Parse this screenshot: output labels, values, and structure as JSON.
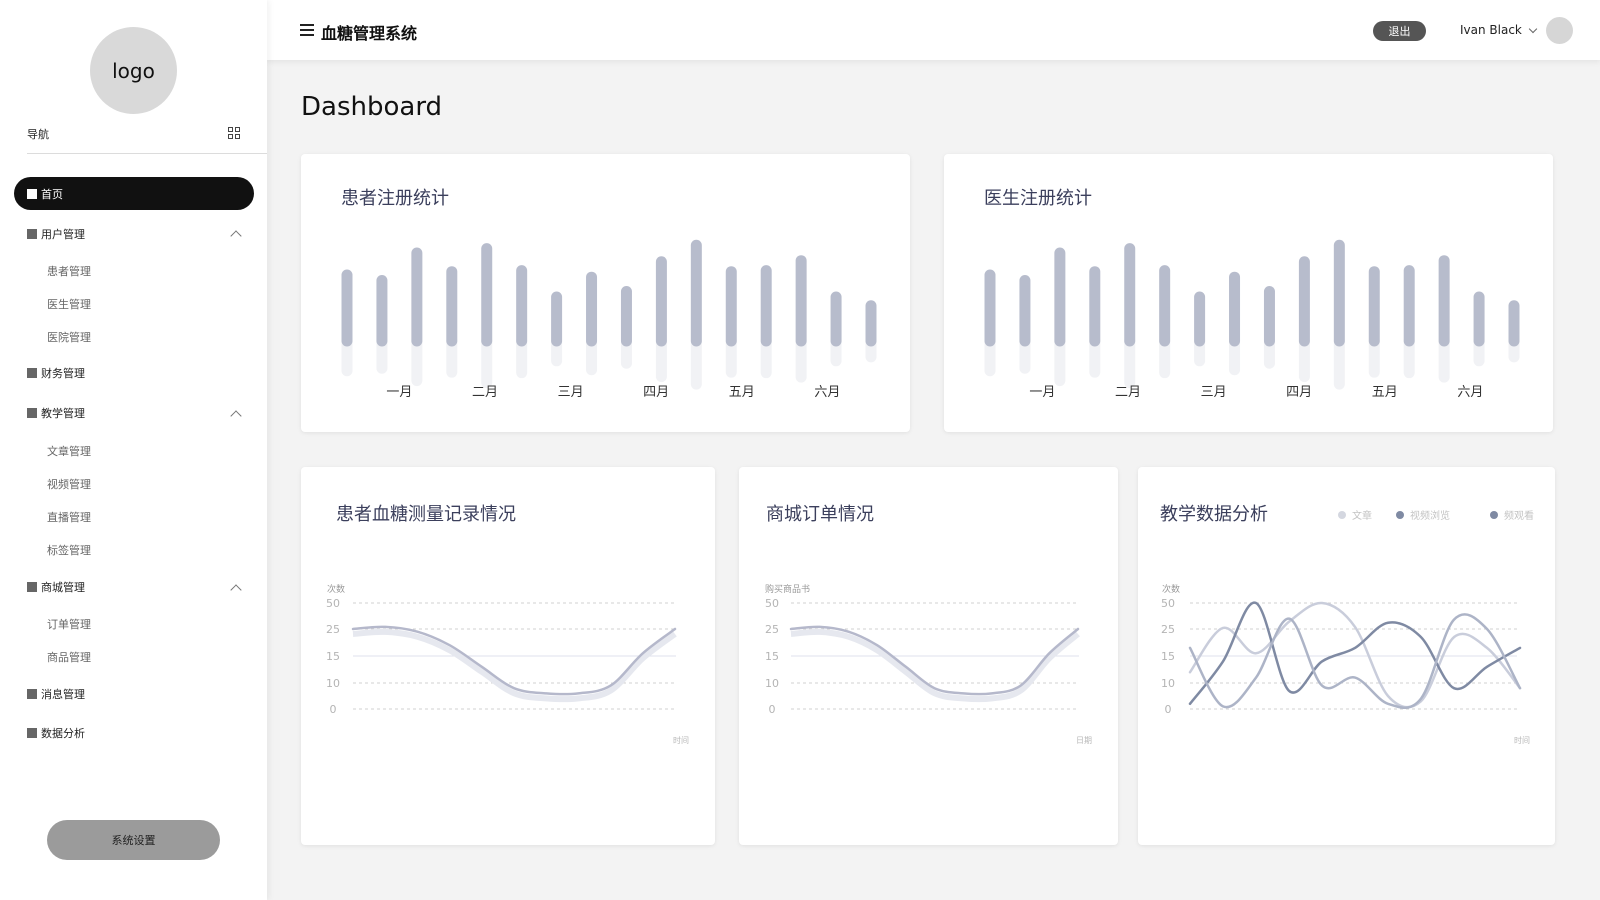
{
  "app": {
    "title": "血糖管理系统",
    "logo_text": "logo"
  },
  "topbar": {
    "logout_label": "退出",
    "user_name": "Ivan Black"
  },
  "nav": {
    "header": "导航",
    "items": [
      {
        "label": "首页",
        "active": true
      },
      {
        "label": "用户管理",
        "expanded": true,
        "children": [
          "患者管理",
          "医生管理",
          "医院管理"
        ]
      },
      {
        "label": "财务管理"
      },
      {
        "label": "教学管理",
        "expanded": true,
        "children": [
          "文章管理",
          "视频管理",
          "直播管理",
          "标签管理"
        ]
      },
      {
        "label": "商城管理",
        "expanded": true,
        "children": [
          "订单管理",
          "商品管理"
        ]
      },
      {
        "label": "消息管理"
      },
      {
        "label": "数据分析"
      }
    ],
    "settings_label": "系统设置"
  },
  "page": {
    "title": "Dashboard"
  },
  "colors": {
    "bar": "#b7bccc",
    "line": "#b5b8cb",
    "accent_dark": "#111111",
    "series": [
      "#c9cddb",
      "#7f8aa3",
      "#adb4c7"
    ]
  },
  "chart_data": [
    {
      "type": "bar",
      "title": "患者注册统计",
      "categories": [
        "一月",
        "二月",
        "三月",
        "四月",
        "五月",
        "六月"
      ],
      "values": [
        60,
        55,
        80,
        63,
        84,
        64,
        40,
        58,
        45,
        72,
        87,
        63,
        64,
        73,
        40,
        32
      ],
      "grid": false
    },
    {
      "type": "bar",
      "title": "医生注册统计",
      "categories": [
        "一月",
        "二月",
        "三月",
        "四月",
        "五月",
        "六月"
      ],
      "values": [
        60,
        55,
        80,
        63,
        84,
        64,
        40,
        58,
        45,
        72,
        87,
        63,
        64,
        73,
        40,
        32
      ],
      "grid": false
    },
    {
      "type": "line",
      "title": "患者血糖测量记录情况",
      "ylabel": "次数",
      "xlabel": "时间",
      "yticks": [
        "50",
        "25",
        "15",
        "10",
        "0"
      ],
      "series": [
        {
          "x": [
            0,
            0.1,
            0.2,
            0.3,
            0.4,
            0.5,
            0.6,
            0.7,
            0.8,
            0.9,
            1.0
          ],
          "values": [
            25,
            27,
            24,
            19,
            13,
            8,
            6,
            6,
            9,
            16,
            25
          ]
        }
      ],
      "grid": true
    },
    {
      "type": "line",
      "title": "商城订单情况",
      "ylabel": "购买商品书",
      "xlabel": "日期",
      "yticks": [
        "50",
        "25",
        "15",
        "10",
        "0"
      ],
      "series": [
        {
          "x": [
            0,
            0.1,
            0.2,
            0.3,
            0.4,
            0.5,
            0.6,
            0.7,
            0.8,
            0.9,
            1.0
          ],
          "values": [
            25,
            27,
            24,
            19,
            13,
            8,
            6,
            6,
            9,
            16,
            25
          ]
        }
      ],
      "grid": true
    },
    {
      "type": "line",
      "title": "教学数据分析",
      "ylabel": "次数",
      "xlabel": "时间",
      "yticks": [
        "50",
        "25",
        "15",
        "10",
        "0"
      ],
      "legend": [
        "文章",
        "视频浏览",
        "频观看"
      ],
      "legend_position": "top-right",
      "series": [
        {
          "name": "文章",
          "x": [
            0,
            0.1,
            0.2,
            0.3,
            0.4,
            0.5,
            0.6,
            0.7,
            0.8,
            0.9,
            1.0
          ],
          "values": [
            12,
            26,
            16,
            32,
            50,
            27,
            5,
            3,
            22,
            18,
            8
          ]
        },
        {
          "name": "视频浏览",
          "x": [
            0,
            0.1,
            0.2,
            0.3,
            0.4,
            0.5,
            0.6,
            0.7,
            0.8,
            0.9,
            1.0
          ],
          "values": [
            2,
            14,
            50,
            7,
            14,
            18,
            31,
            22,
            8,
            13,
            18
          ]
        },
        {
          "name": "频观看",
          "x": [
            0,
            0.1,
            0.2,
            0.3,
            0.4,
            0.5,
            0.6,
            0.7,
            0.8,
            0.9,
            1.0
          ],
          "values": [
            18,
            1,
            11,
            35,
            9,
            11,
            2,
            4,
            34,
            25,
            8
          ]
        }
      ],
      "grid": true
    }
  ]
}
